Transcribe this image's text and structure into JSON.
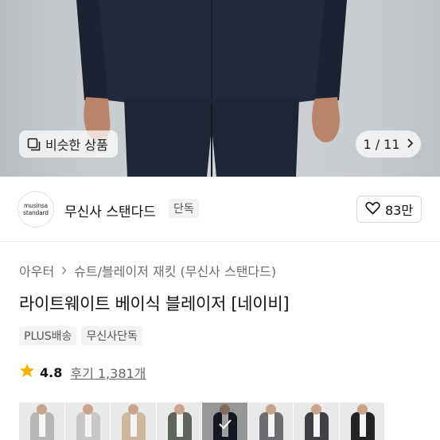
{
  "hero": {
    "similar_label": "비슷한 상품",
    "counter_text": "1 / 11"
  },
  "brand": {
    "logo_line1": "musinsa",
    "logo_line2": "standard",
    "name": "무신사 스탠다드",
    "badge": "단독",
    "likes": "83만"
  },
  "breadcrumb": {
    "level1": "아우터",
    "level2": "슈트/블레이저 재킷 (무신사 스탠다드)"
  },
  "product": {
    "title": "라이트웨이트 베이식 블레이저 [네이비]",
    "tags": [
      "PLUS배송",
      "무신사단독"
    ],
    "rating": "4.8",
    "reviews": "후기 1,381개"
  },
  "swatches": [
    {
      "color": "#b7b7b5"
    },
    {
      "color": "#c9c8c6"
    },
    {
      "color": "#cdb79e"
    },
    {
      "color": "#5f655e"
    },
    {
      "color": "#1f2535",
      "selected": true
    },
    {
      "color": "#6c6e72"
    },
    {
      "color": "#3f4146"
    },
    {
      "color": "#232325"
    }
  ],
  "colors": {
    "star": "#f5b400",
    "suit": "#1f2738"
  }
}
